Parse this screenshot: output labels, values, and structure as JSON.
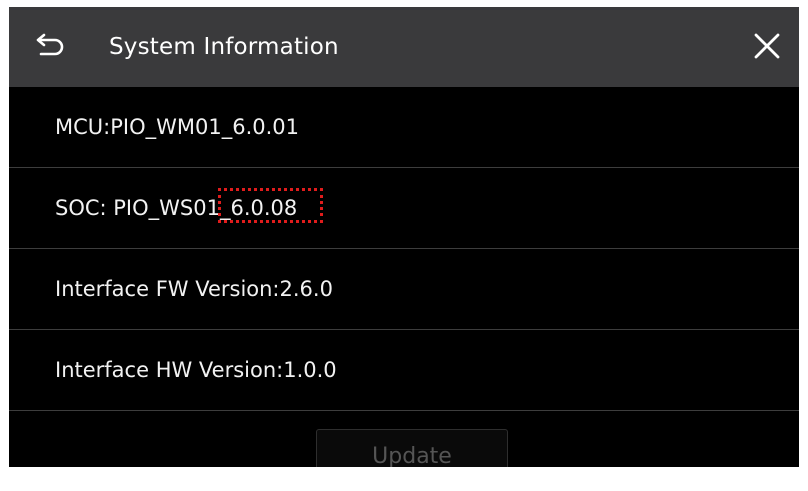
{
  "header": {
    "title": "System Information",
    "back_icon": "return-arrow-icon",
    "close_icon": "close-x-icon"
  },
  "info": {
    "mcu": {
      "label": "MCU: ",
      "value": "PIO_WM01_6.0.01"
    },
    "soc": {
      "label": "SOC: PIO_WS01_",
      "value": "6.0.08",
      "highlight_color": "#e01c1c"
    },
    "interface_fw": {
      "label": "Interface FW Version: ",
      "value": "2.6.0"
    },
    "interface_hw": {
      "label": "Interface HW Version: ",
      "value": "1.0.0"
    }
  },
  "footer": {
    "update_label": "Update",
    "update_state": "disabled"
  },
  "colors": {
    "header_bg": "#3a3a3c",
    "screen_bg": "#000000",
    "text": "#f2f2f2",
    "disabled_text": "#555555"
  }
}
